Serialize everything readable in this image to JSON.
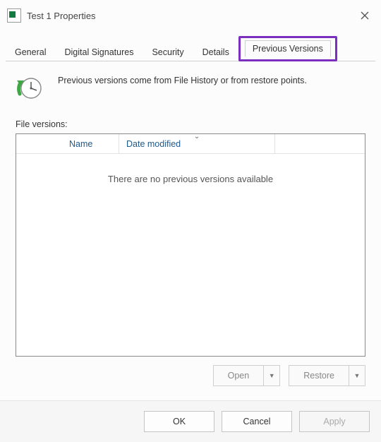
{
  "titlebar": {
    "title": "Test 1 Properties"
  },
  "tabs": {
    "general": "General",
    "digital_signatures": "Digital Signatures",
    "security": "Security",
    "details": "Details",
    "previous_versions": "Previous Versions"
  },
  "panel": {
    "info": "Previous versions come from File History or from restore points.",
    "section_label": "File versions:",
    "columns": {
      "name": "Name",
      "date_modified": "Date modified"
    },
    "empty": "There are no previous versions available"
  },
  "actions": {
    "open": "Open",
    "restore": "Restore"
  },
  "buttons": {
    "ok": "OK",
    "cancel": "Cancel",
    "apply": "Apply"
  }
}
